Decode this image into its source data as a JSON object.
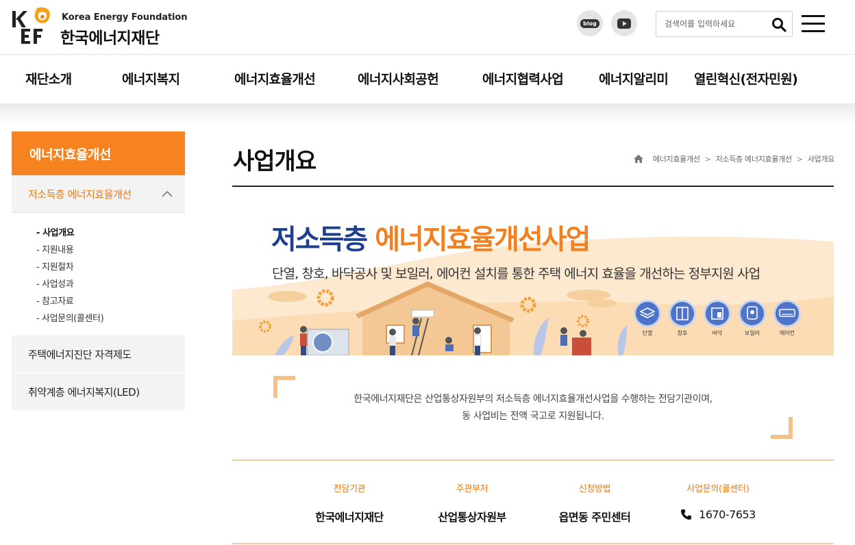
{
  "header": {
    "logo_en": "Korea Energy Foundation",
    "logo_ko": "한국에너지재단",
    "blog_label": "blog",
    "search_placeholder": "검색어를 입력하세요"
  },
  "gnb": {
    "items": [
      "재단소개",
      "에너지복지",
      "에너지효율개선",
      "에너지사회공헌",
      "에너지협력사업",
      "에너지알리미",
      "열린혁신(전자민원)"
    ]
  },
  "sidebar": {
    "title": "에너지효율개선",
    "active_section": "저소득층 에너지효율개선",
    "sub_items": [
      "- 사업개요",
      "- 지원내용",
      "- 지원절차",
      "- 사업성과",
      "- 참고자료",
      "- 사업문의(콜센터)"
    ],
    "other_sections": [
      "주택에너지진단 자격제도",
      "취약계층 에너지복지(LED)"
    ]
  },
  "content": {
    "page_title": "사업개요",
    "breadcrumb": [
      "에너지효율개선",
      "저소득층 에너지효율개선",
      "사업개요"
    ],
    "banner": {
      "title_part1": "저소득층",
      "title_part2": "에너지효율개선사업",
      "subtitle": "단열, 창호, 바닥공사 및 보일러, 에어컨 설치를 통한 주택 에너지 효율을 개선하는 정부지원 사업",
      "badges": [
        "단열",
        "창호",
        "바닥",
        "보일러",
        "에어컨"
      ]
    },
    "intro_line1": "한국에너지재단은 산업통상자원부의 저소득층 에너지효율개선사업을 수행하는 전담기관이며,",
    "intro_line2": "동 사업비는 전액 국고로 지원됩니다.",
    "info": [
      {
        "label": "전담기관",
        "value": "한국에너지재단"
      },
      {
        "label": "주관부처",
        "value": "산업통상자원부"
      },
      {
        "label": "신청방법",
        "value": "읍면동 주민센터"
      },
      {
        "label": "사업문의(콜센터)",
        "value": "1670-7653"
      }
    ]
  },
  "colors": {
    "accent_orange": "#f68320",
    "navy": "#1f3f90",
    "badge_blue": "#4f73c8",
    "quote_beige": "#f3c089"
  }
}
